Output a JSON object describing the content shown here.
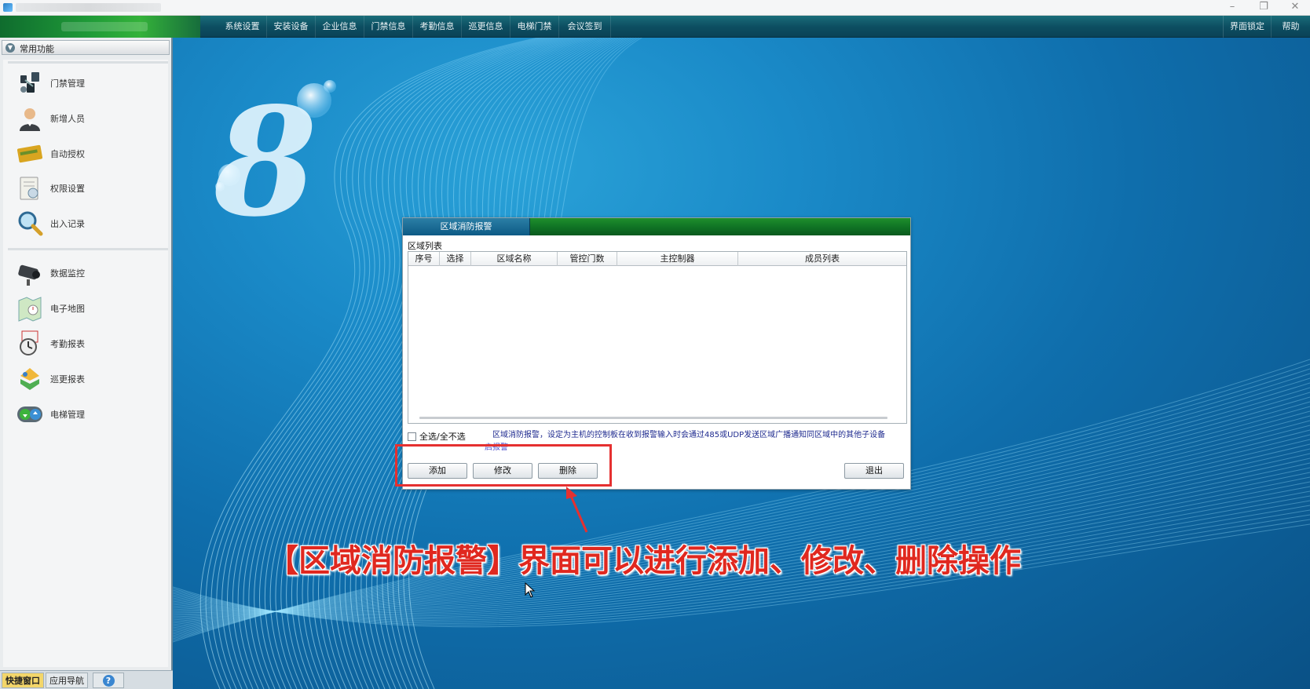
{
  "window": {
    "minimize": "–",
    "restore": "❐",
    "close": "✕"
  },
  "menu": {
    "items": [
      "系统设置",
      "安装设备",
      "企业信息",
      "门禁信息",
      "考勤信息",
      "巡更信息",
      "电梯门禁",
      "会议签到"
    ],
    "right_items": [
      "界面锁定",
      "帮助"
    ]
  },
  "sidebar": {
    "header": "常用功能",
    "group1": [
      {
        "label": "门禁管理",
        "icon": "door-access-icon"
      },
      {
        "label": "新增人员",
        "icon": "person-icon"
      },
      {
        "label": "自动授权",
        "icon": "card-icon"
      },
      {
        "label": "权限设置",
        "icon": "permission-icon"
      },
      {
        "label": "出入记录",
        "icon": "magnifier-icon"
      }
    ],
    "group2": [
      {
        "label": "数据监控",
        "icon": "camera-icon"
      },
      {
        "label": "电子地图",
        "icon": "map-icon"
      },
      {
        "label": "考勤报表",
        "icon": "clock-icon"
      },
      {
        "label": "巡更报表",
        "icon": "patrol-icon"
      },
      {
        "label": "电梯管理",
        "icon": "elevator-icon"
      }
    ]
  },
  "bottom_tabs": {
    "quick": "快捷窗口",
    "nav": "应用导航",
    "help": "?"
  },
  "logo": {
    "glyph": "8"
  },
  "dialog": {
    "tab": "区域消防报警",
    "section": "区域列表",
    "columns": [
      "序号",
      "选择",
      "区域名称",
      "管控门数",
      "主控制器",
      "成员列表"
    ],
    "rows": [],
    "select_all": "全选/全不选",
    "note": "区域消防报警，设定为主机的控制板在收到报警输入时会通过485或UDP发送区域广播通知同区域中的其他子设备",
    "note_wrap": "启报警",
    "buttons": {
      "add": "添加",
      "edit": "修改",
      "delete": "删除",
      "exit": "退出"
    }
  },
  "caption": "【区域消防报警】界面可以进行添加、修改、删除操作",
  "colors": {
    "annotation": "#e53030",
    "caption": "#e0281f",
    "note": "#1e2a8f"
  }
}
